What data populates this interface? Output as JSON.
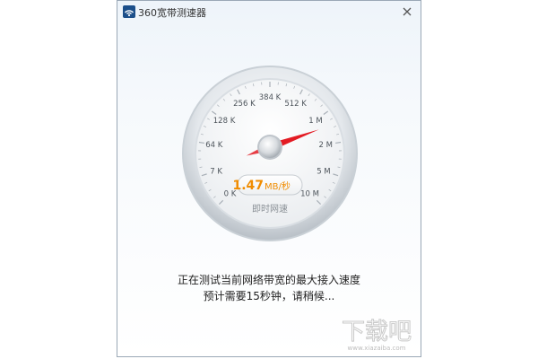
{
  "window": {
    "title": "360宽带测速器",
    "close_glyph": "×",
    "app_icon": "wifi-signal-icon"
  },
  "gauge": {
    "tick_labels": [
      "0 K",
      "7 K",
      "64 K",
      "128 K",
      "256 K",
      "384 K",
      "512 K",
      "1 M",
      "2 M",
      "5 M",
      "10 M"
    ],
    "speed_value": "1.47",
    "speed_unit": "MB/秒",
    "caption": "即时网速",
    "needle_position": 7.6,
    "needle_color": "#e31b23",
    "value_color": "#f08c00"
  },
  "status": {
    "line1": "正在测试当前网络带宽的最大接入速度",
    "line2": "预计需要15秒钟，请稍候..."
  },
  "watermark": {
    "text": "下载吧",
    "url": "www.xiazaiba.com"
  }
}
